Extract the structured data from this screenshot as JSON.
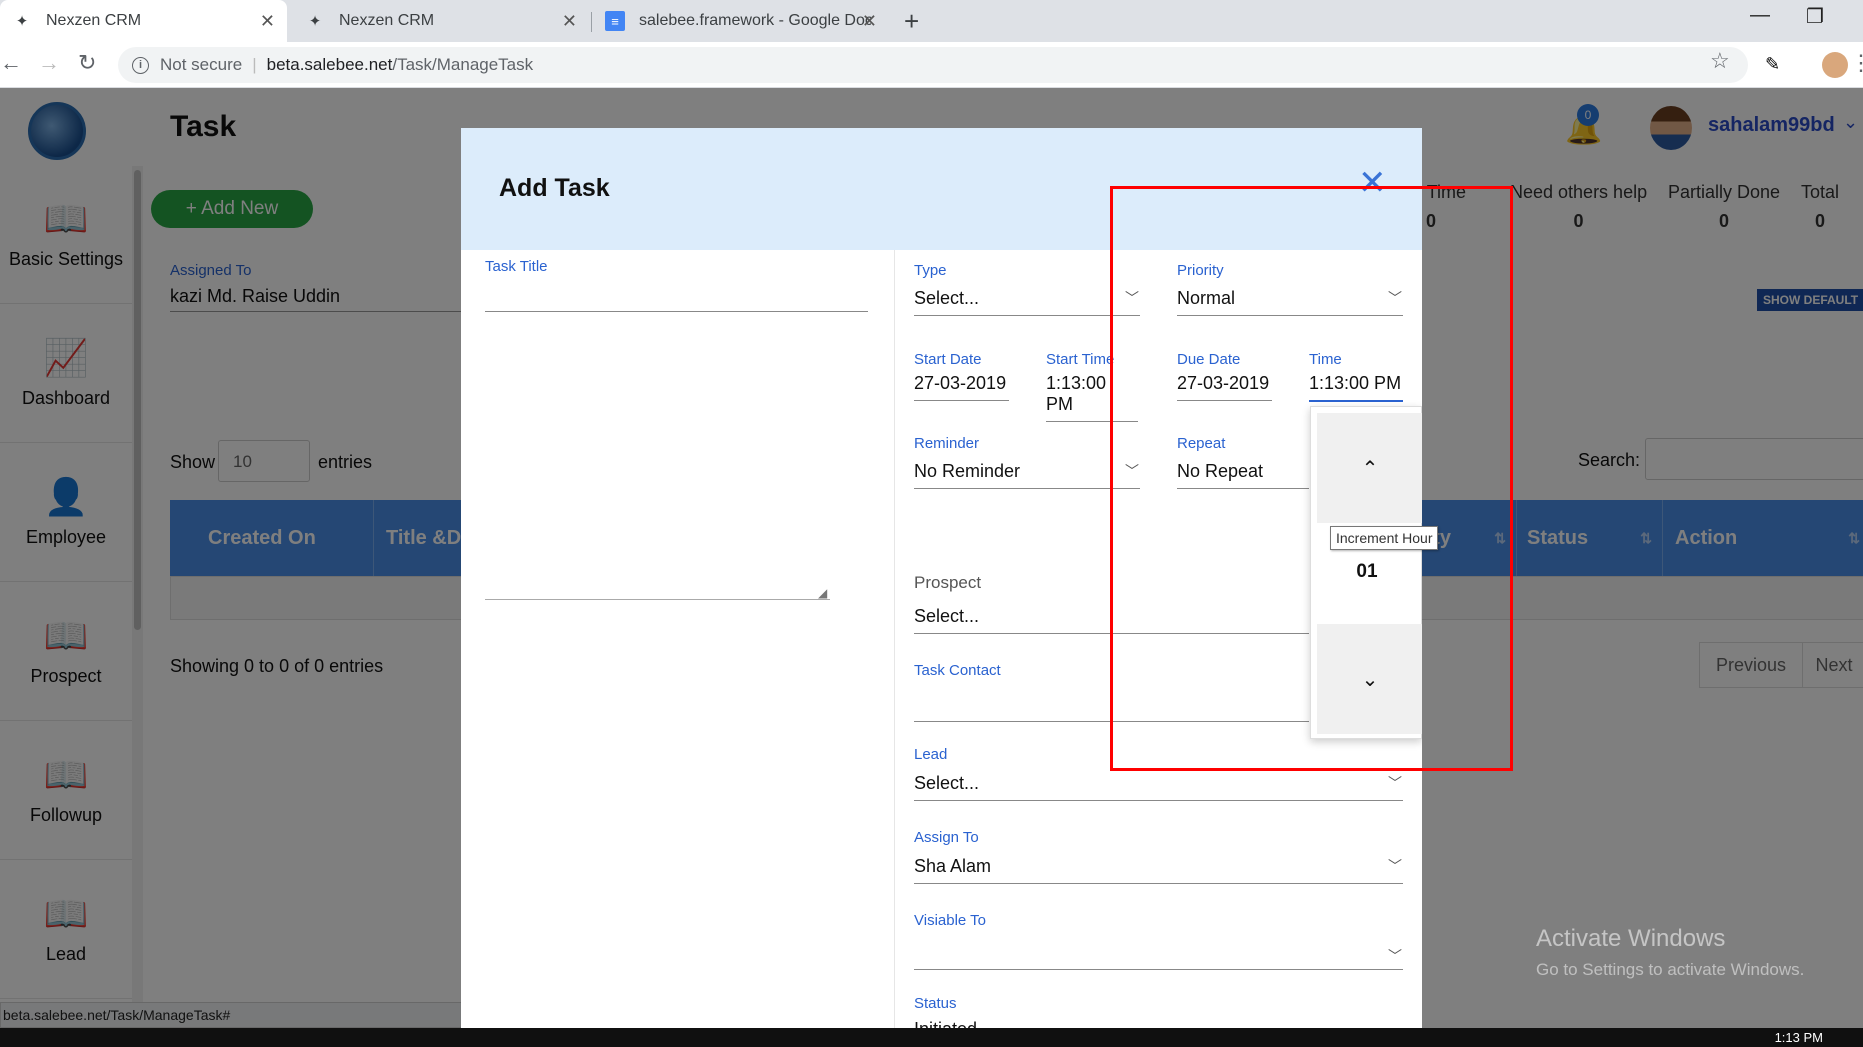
{
  "browser": {
    "tabs": [
      {
        "title": "Nexzen CRM",
        "active": true
      },
      {
        "title": "Nexzen CRM",
        "active": false
      },
      {
        "title": "salebee.framework - Google Doc",
        "active": false
      }
    ],
    "address": {
      "security": "Not secure",
      "host": "beta.salebee.net",
      "path": "/Task/ManageTask"
    },
    "status_url": "beta.salebee.net/Task/ManageTask#"
  },
  "header": {
    "page_title": "Task",
    "notification_count": "0",
    "username": "sahalam99bd"
  },
  "sidebar": {
    "items": [
      {
        "label": "Basic Settings",
        "icon": "book-icon"
      },
      {
        "label": "Dashboard",
        "icon": "chart-line-icon"
      },
      {
        "label": "Employee",
        "icon": "user-icon"
      },
      {
        "label": "Prospect",
        "icon": "book-icon"
      },
      {
        "label": "Followup",
        "icon": "book-icon"
      },
      {
        "label": "Lead",
        "icon": "book-icon"
      }
    ]
  },
  "main": {
    "add_new": "+ Add New",
    "stats": [
      {
        "label": "ore Time",
        "value": "0"
      },
      {
        "label": "Need others help",
        "value": "0"
      },
      {
        "label": "Partially Done",
        "value": "0"
      },
      {
        "label": "Total",
        "value": "0"
      }
    ],
    "assigned_label": "Assigned To",
    "assigned_value": "kazi Md. Raise Uddin",
    "show_default": "SHOW DEFAULT",
    "show_label": "Show",
    "show_value": "10",
    "entries_label": "entries",
    "search_label": "Search:",
    "columns": [
      "Created On",
      "Title &D",
      "Priority",
      "Status",
      "Action"
    ],
    "showing": "Showing 0 to 0 of 0 entries",
    "prev": "Previous",
    "next": "Next"
  },
  "modal": {
    "title": "Add Task",
    "task_title_label": "Task Title",
    "type_label": "Type",
    "type_value": "Select...",
    "priority_label": "Priority",
    "priority_value": "Normal",
    "start_date_label": "Start Date",
    "start_date_value": "27-03-2019",
    "start_time_label": "Start Time",
    "start_time_value": "1:13:00 PM",
    "due_date_label": "Due Date",
    "due_date_value": "27-03-2019",
    "time_label": "Time",
    "time_value": "1:13:00 PM",
    "reminder_label": "Reminder",
    "reminder_value": "No Reminder",
    "repeat_label": "Repeat",
    "repeat_value": "No Repeat",
    "prospect_label": "Prospect",
    "prospect_value": "Select...",
    "task_contact_label": "Task Contact",
    "lead_label": "Lead",
    "lead_value": "Select...",
    "assign_to_label": "Assign To",
    "assign_to_value": "Sha Alam",
    "visible_to_label": "Visiable To",
    "status_label": "Status",
    "status_value": "Initiated",
    "picker_hour": "01",
    "picker_tooltip": "Increment Hour"
  },
  "watermark": {
    "line1": "Activate Windows",
    "line2": "Go to Settings to activate Windows."
  },
  "taskbar": {
    "clock": "1:13 PM"
  },
  "colors": {
    "accent": "#2a62d0",
    "table_header": "#4b8ee8",
    "add_new": "#28a745",
    "highlight": "#ff0000"
  }
}
